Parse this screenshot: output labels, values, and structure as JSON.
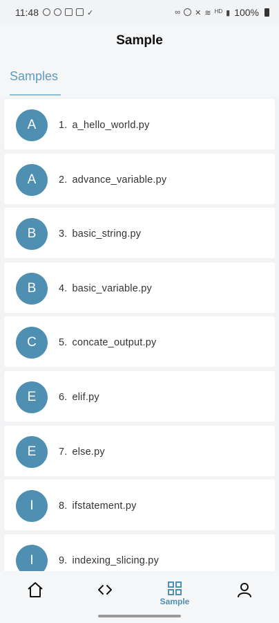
{
  "status": {
    "time": "11:48",
    "battery": "100%",
    "network": "HD"
  },
  "header": {
    "title": "Sample"
  },
  "tabs": [
    {
      "label": "Samples"
    }
  ],
  "items": [
    {
      "letter": "A",
      "num": "1.",
      "name": "a_hello_world.py"
    },
    {
      "letter": "A",
      "num": "2.",
      "name": "advance_variable.py"
    },
    {
      "letter": "B",
      "num": "3.",
      "name": "basic_string.py"
    },
    {
      "letter": "B",
      "num": "4.",
      "name": "basic_variable.py"
    },
    {
      "letter": "C",
      "num": "5.",
      "name": "concate_output.py"
    },
    {
      "letter": "E",
      "num": "6.",
      "name": "elif.py"
    },
    {
      "letter": "E",
      "num": "7.",
      "name": "else.py"
    },
    {
      "letter": "I",
      "num": "8.",
      "name": "ifstatement.py"
    },
    {
      "letter": "I",
      "num": "9.",
      "name": "indexing_slicing.py"
    }
  ],
  "nav": {
    "sample_label": "Sample",
    "icons": [
      "home-icon",
      "code-icon",
      "grid-icon",
      "user-icon"
    ]
  },
  "colors": {
    "accent": "#4f8fb1",
    "tab_text": "#5c9cba",
    "background": "#f2f3f5"
  }
}
